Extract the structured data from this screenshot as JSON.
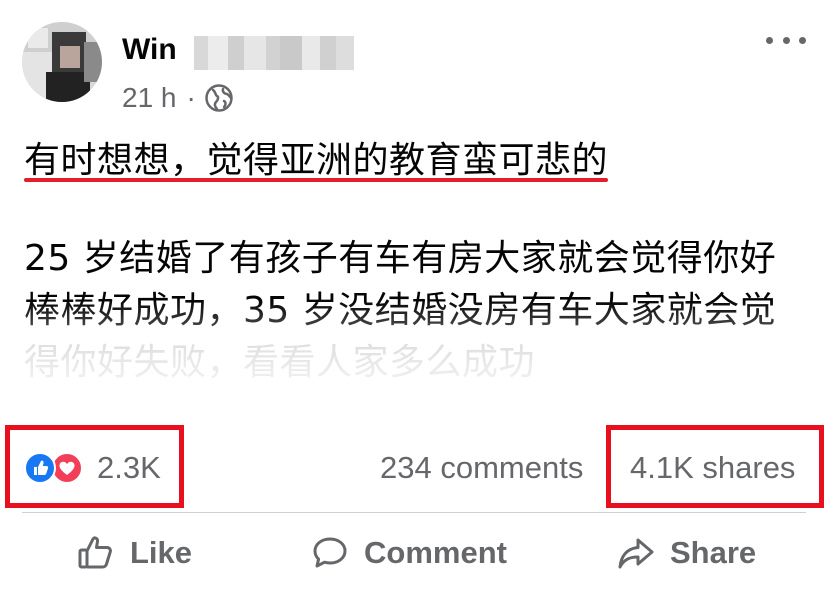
{
  "post": {
    "author": {
      "name_visible": "Win",
      "name_obscured": true
    },
    "timestamp": "21 h",
    "separator": "·",
    "audience_icon": "globe-icon",
    "more_icon": "more-options-icon",
    "headline": "有时想想，觉得亚洲的教育蛮可悲的",
    "body_lines": [
      "25 岁结婚了有孩子有车有房大家就会觉得你好",
      "棒棒好成功，35 岁没结婚没房有车大家就会觉",
      "得你好失败，看看人家多么成功"
    ]
  },
  "stats": {
    "reaction_icons": [
      "like-reaction-icon",
      "love-reaction-icon"
    ],
    "reactions": "2.3K",
    "comments": "234 comments",
    "shares": "4.1K shares"
  },
  "actions": {
    "like_label": "Like",
    "comment_label": "Comment",
    "share_label": "Share"
  },
  "colors": {
    "text_primary": "#050505",
    "text_secondary": "#65676b",
    "like_blue": "#1877f2",
    "love_red": "#f33e58",
    "annotation_red": "#e8101e",
    "headline_underline_red": "#e41e2a",
    "divider": "#ced0d4"
  }
}
